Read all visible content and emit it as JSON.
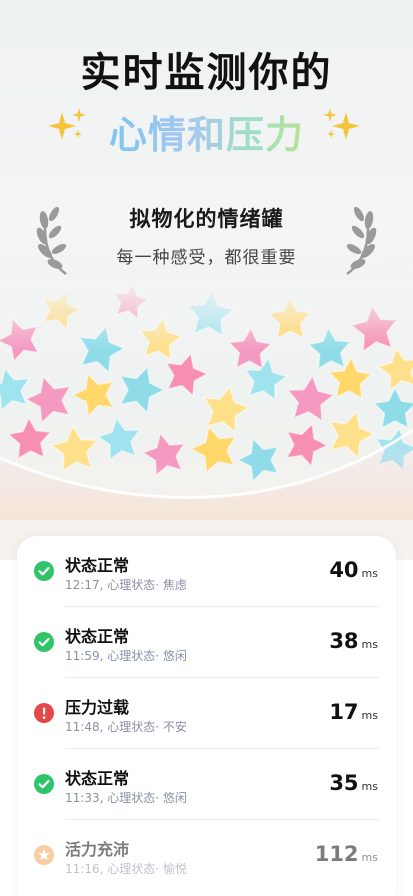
{
  "hero": {
    "headline": "实时监测你的",
    "subline": "心情和压力",
    "jar_title": "拟物化的情绪罐",
    "jar_subtitle": "每一种感受，都很重要"
  },
  "records": [
    {
      "status": "状态正常",
      "time": "12:17,",
      "detail": "心理状态· 焦虑",
      "value": "40",
      "unit": "ms",
      "icon": "check-icon",
      "color": "#2fc46a"
    },
    {
      "status": "状态正常",
      "time": "11:59,",
      "detail": "心理状态· 悠闲",
      "value": "38",
      "unit": "ms",
      "icon": "check-icon",
      "color": "#2fc46a"
    },
    {
      "status": "压力过载",
      "time": "11:48,",
      "detail": "心理状态· 不安",
      "value": "17",
      "unit": "ms",
      "icon": "alert-icon",
      "color": "#e54848"
    },
    {
      "status": "状态正常",
      "time": "11:33,",
      "detail": "心理状态· 悠闲",
      "value": "35",
      "unit": "ms",
      "icon": "check-icon",
      "color": "#2fc46a"
    },
    {
      "status": "活力充沛",
      "time": "11:16,",
      "detail": "心理状态· 愉悦",
      "value": "112",
      "unit": "ms",
      "icon": "star-badge-icon",
      "color": "#f2a65a"
    }
  ]
}
